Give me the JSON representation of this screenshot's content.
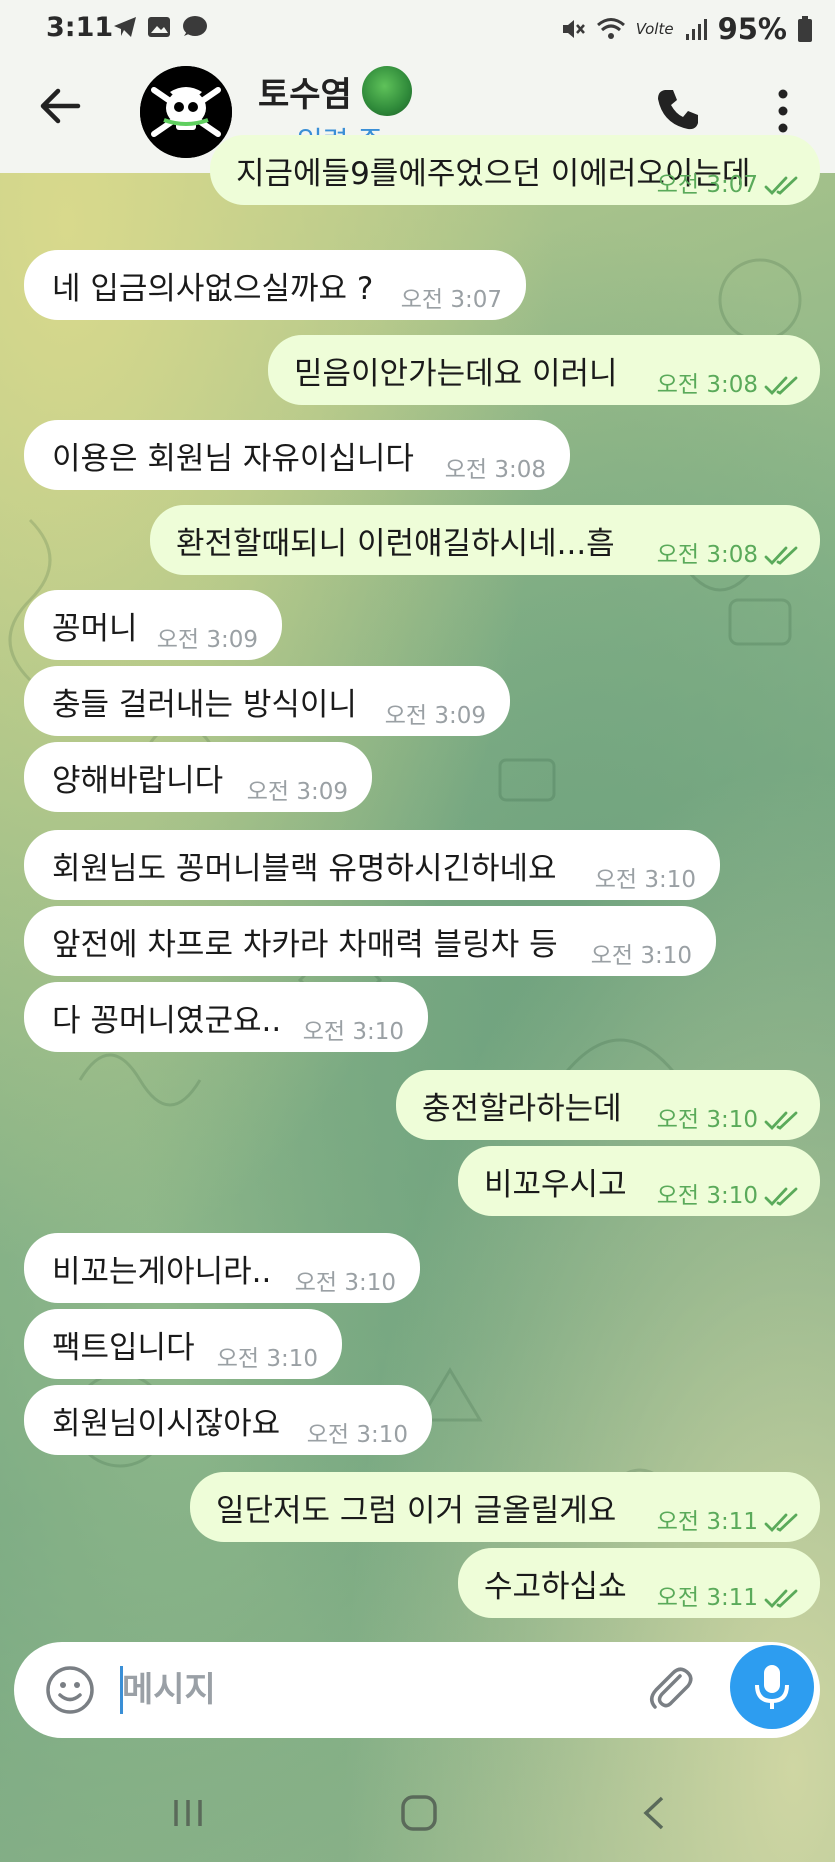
{
  "status_bar": {
    "time": "3:11",
    "battery": "95%",
    "network_label": "Volte"
  },
  "header": {
    "title": "토수염",
    "status": "입력 중"
  },
  "messages": [
    {
      "dir": "out",
      "text": "지금에들9를에주었으던 이에러오이는데",
      "time": "오전 3:07"
    },
    {
      "dir": "in",
      "text": "네 입금의사없으실까요 ?",
      "time": "오전 3:07"
    },
    {
      "dir": "out",
      "text": "믿음이안가는데요 이러니",
      "time": "오전 3:08"
    },
    {
      "dir": "in",
      "text": "이용은 회원님 자유이십니다",
      "time": "오전 3:08"
    },
    {
      "dir": "out",
      "text": "환전할때되니 이런얘길하시네...흠",
      "time": "오전 3:08"
    },
    {
      "dir": "in",
      "text": "꽁머니",
      "time": "오전 3:09"
    },
    {
      "dir": "in",
      "text": "충들 걸러내는 방식이니",
      "time": "오전 3:09"
    },
    {
      "dir": "in",
      "text": "양해바랍니다",
      "time": "오전 3:09"
    },
    {
      "dir": "in",
      "text": "회원님도 꽁머니블랙 유명하시긴하네요",
      "time": "오전 3:10"
    },
    {
      "dir": "in",
      "text": "앞전에 차프로 차카라 차매력 블링차 등",
      "time": "오전 3:10"
    },
    {
      "dir": "in",
      "text": "다 꽁머니였군요..",
      "time": "오전 3:10"
    },
    {
      "dir": "out",
      "text": "충전할라하는데",
      "time": "오전 3:10"
    },
    {
      "dir": "out",
      "text": "비꼬우시고",
      "time": "오전 3:10"
    },
    {
      "dir": "in",
      "text": "비꼬는게아니라..",
      "time": "오전 3:10"
    },
    {
      "dir": "in",
      "text": "팩트입니다",
      "time": "오전 3:10"
    },
    {
      "dir": "in",
      "text": "회원님이시잖아요",
      "time": "오전 3:10"
    },
    {
      "dir": "out",
      "text": "일단저도 그럼 이거 글올릴게요",
      "time": "오전 3:11"
    },
    {
      "dir": "out",
      "text": "수고하십쇼",
      "time": "오전 3:11"
    }
  ],
  "input": {
    "placeholder": "메시지"
  },
  "icons": {
    "back": "arrow-left-icon",
    "call": "phone-icon",
    "menu": "more-vertical-icon",
    "emoji": "smiley-icon",
    "attach": "paperclip-icon",
    "mic": "microphone-icon"
  },
  "colors": {
    "incoming_bubble": "#ffffff",
    "outgoing_bubble": "#eefdd8",
    "outgoing_time": "#5aaa5a",
    "accent": "#2d9df0"
  }
}
